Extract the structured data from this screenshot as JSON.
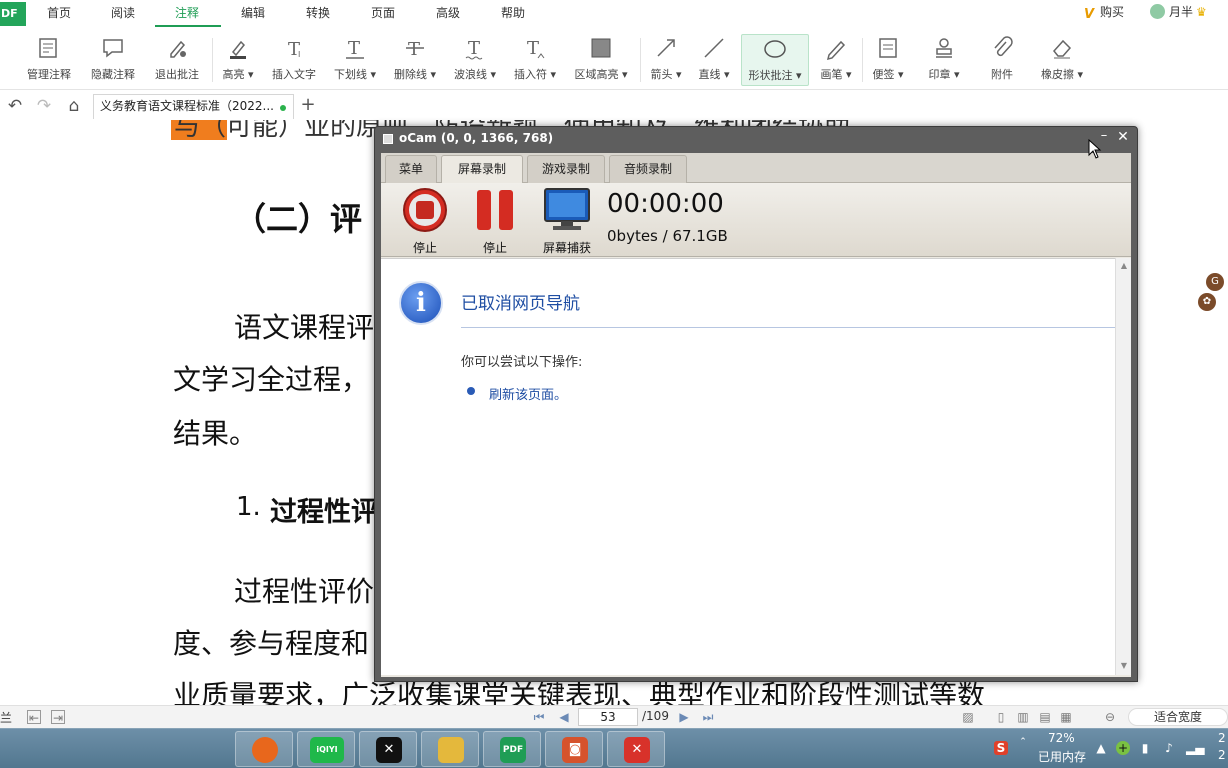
{
  "app": {
    "logo_text": "DF"
  },
  "menu": {
    "items": [
      "首页",
      "阅读",
      "注释",
      "编辑",
      "转换",
      "页面",
      "高级",
      "帮助"
    ],
    "active_index": 2,
    "buy_label": "购买",
    "user_label": "月半"
  },
  "ribbon": {
    "buttons": [
      {
        "label": "管理注释",
        "icon": "manage-annotations-icon"
      },
      {
        "label": "隐藏注释",
        "icon": "hide-annotations-icon"
      },
      {
        "label": "退出批注",
        "icon": "exit-annotation-icon"
      },
      {
        "label": "高亮",
        "icon": "highlight-icon",
        "dropdown": true
      },
      {
        "label": "插入文字",
        "icon": "insert-text-icon"
      },
      {
        "label": "下划线",
        "icon": "underline-icon",
        "dropdown": true
      },
      {
        "label": "删除线",
        "icon": "strikethrough-icon",
        "dropdown": true
      },
      {
        "label": "波浪线",
        "icon": "wavy-line-icon",
        "dropdown": true
      },
      {
        "label": "插入符",
        "icon": "caret-icon",
        "dropdown": true
      },
      {
        "label": "区域高亮",
        "icon": "area-highlight-icon",
        "dropdown": true
      },
      {
        "label": "箭头",
        "icon": "arrow-icon",
        "dropdown": true
      },
      {
        "label": "直线",
        "icon": "line-icon",
        "dropdown": true
      },
      {
        "label": "形状批注",
        "icon": "shape-ellipse-icon",
        "dropdown": true,
        "selected": true
      },
      {
        "label": "画笔",
        "icon": "pen-icon",
        "dropdown": true
      },
      {
        "label": "便签",
        "icon": "sticky-note-icon",
        "dropdown": true
      },
      {
        "label": "印章",
        "icon": "stamp-icon",
        "dropdown": true
      },
      {
        "label": "附件",
        "icon": "attachment-icon"
      },
      {
        "label": "橡皮擦",
        "icon": "eraser-icon",
        "dropdown": true
      }
    ]
  },
  "tabs": {
    "doc_title": "义务教育语文课程标准（2022...",
    "add_symbol": "+"
  },
  "document": {
    "top_fragment": "与（可能）业的原则，防设新颖，使用知及，维利团结协助。",
    "heading": "（二）评",
    "para1_line1": "语文课程评",
    "para1_line2": "文学习全过程，",
    "para1_line3": "结果。",
    "subheading_num": "1.",
    "subheading": "过程性评",
    "para2_line1": "过程性评价",
    "para2_line2": "度、参与程度和",
    "para2_line3": "业质量要求，广泛收集课堂关键表现、典型作业和阶段性测试等数"
  },
  "ocam": {
    "title": "oCam (0, 0, 1366, 768)",
    "tabs": [
      "菜单",
      "屏幕录制",
      "游戏录制",
      "音频录制"
    ],
    "active_tab": 1,
    "buttons": [
      {
        "label": "停止",
        "icon": "record-stop-icon"
      },
      {
        "label": "停止",
        "icon": "pause-icon"
      },
      {
        "label": "屏幕捕获",
        "icon": "screen-capture-icon"
      }
    ],
    "time": "00:00:00",
    "size": "0bytes / 67.1GB",
    "browser": {
      "title": "已取消网页导航",
      "hint": "你可以尝试以下操作:",
      "link": "刷新该页面。"
    }
  },
  "statusbar": {
    "left_label": "兰",
    "page_current": "53",
    "page_total": "/109",
    "fit_label": "适合宽度"
  },
  "taskbar": {
    "apps": [
      {
        "name": "firefox",
        "color": "#e8671c",
        "glyph": "●"
      },
      {
        "name": "iqiyi",
        "color": "#1fb84a",
        "glyph": "iQIYI"
      },
      {
        "name": "capcut",
        "color": "#111111",
        "glyph": "✕"
      },
      {
        "name": "file-explorer",
        "color": "#e4b83c",
        "glyph": "▭"
      },
      {
        "name": "pdf-editor",
        "color": "#1f9d55",
        "glyph": "PDF"
      },
      {
        "name": "ocam",
        "color": "#d6532c",
        "glyph": "◙"
      },
      {
        "name": "wps",
        "color": "#d8322a",
        "glyph": "✕"
      }
    ],
    "memory_percent": "72%",
    "memory_label": "已用内存",
    "clock_fragment_1": "2",
    "clock_fragment_2": "2"
  }
}
